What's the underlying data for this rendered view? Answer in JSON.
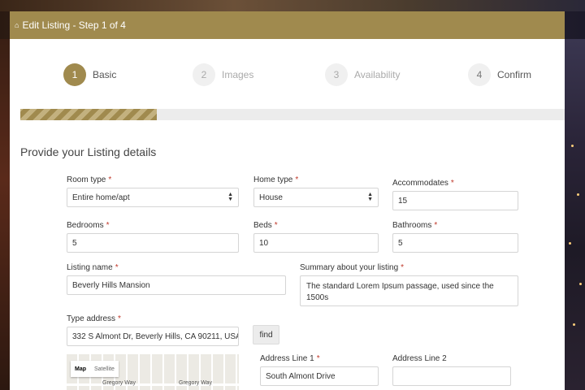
{
  "header": {
    "icon": "home-icon",
    "title": "Edit Listing - Step 1 of 4"
  },
  "steps": [
    {
      "number": "1",
      "label": "Basic"
    },
    {
      "number": "2",
      "label": "Images"
    },
    {
      "number": "3",
      "label": "Availability"
    },
    {
      "number": "4",
      "label": "Confirm"
    }
  ],
  "progress": {
    "fraction": 0.25
  },
  "section_title": "Provide your Listing details",
  "form": {
    "room_type": {
      "label": "Room type",
      "value": "Entire home/apt"
    },
    "home_type": {
      "label": "Home type",
      "value": "House"
    },
    "accommodates": {
      "label": "Accommodates",
      "value": "15"
    },
    "bedrooms": {
      "label": "Bedrooms",
      "value": "5"
    },
    "beds": {
      "label": "Beds",
      "value": "10"
    },
    "bathrooms": {
      "label": "Bathrooms",
      "value": "5"
    },
    "listing_name": {
      "label": "Listing name",
      "value": "Beverly Hills Mansion"
    },
    "summary": {
      "label": "Summary about your listing",
      "value": "The standard Lorem Ipsum passage, used since the 1500s"
    },
    "address": {
      "label": "Type address",
      "value": "332 S Almont Dr, Beverly Hills, CA 90211, USA"
    },
    "find_label": "find",
    "address_line1": {
      "label": "Address Line 1",
      "value": "South Almont Drive"
    },
    "address_line2": {
      "label": "Address Line 2",
      "value": ""
    },
    "required_mark": "*"
  },
  "map": {
    "map_label": "Map",
    "satellite_label": "Satellite",
    "streets": [
      "Gregory Way",
      "Gregory Way"
    ]
  },
  "colors": {
    "accent": "#a08a4e",
    "required": "#c0392b"
  }
}
